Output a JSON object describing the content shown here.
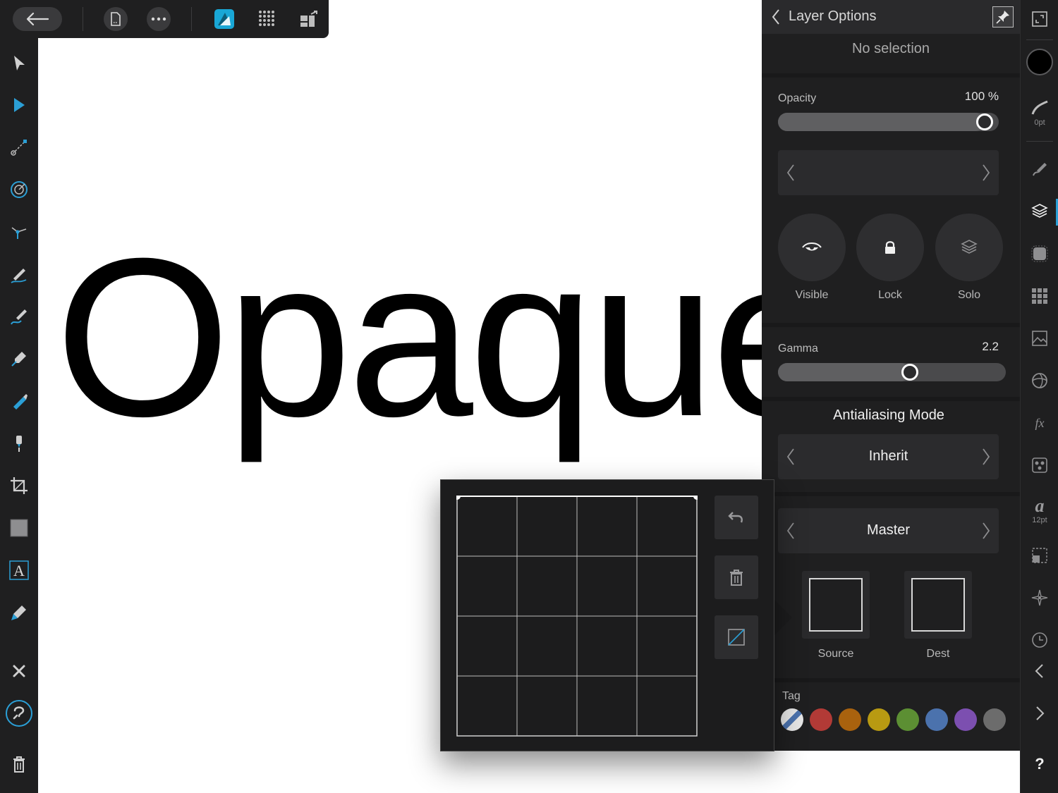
{
  "canvas": {
    "text": "Opaque"
  },
  "topbar": {
    "items": [
      "back-arrow-icon",
      "document-icon",
      "more-icon",
      "app-logo-icon",
      "grid-icon",
      "export-persona-icon"
    ]
  },
  "left_toolbar": {
    "tools": [
      "move-tool-icon",
      "node-tool-icon",
      "fill-tool-icon",
      "transparency-tool-icon",
      "corner-tool-icon",
      "pencil-tool-icon",
      "vector-brush-tool-icon",
      "pen-tool-icon",
      "paint-brush-icon",
      "color-picker-tool-icon",
      "crop-tool-icon",
      "rectangle-tool-icon",
      "artistic-text-tool-icon",
      "eyedropper-icon",
      "close-icon",
      "help-lasso-icon",
      "delete-icon"
    ]
  },
  "panel": {
    "title": "Layer Options",
    "selection_status": "No selection",
    "opacity": {
      "label": "Opacity",
      "value_text": "100 %",
      "value": 1.0
    },
    "visibility": {
      "visible_label": "Visible",
      "lock_label": "Lock",
      "solo_label": "Solo"
    },
    "gamma": {
      "label": "Gamma",
      "value_text": "2.2",
      "value": 0.6
    },
    "antialiasing": {
      "heading": "Antialiasing Mode",
      "value": "Inherit"
    },
    "blend_ranges": {
      "channel": "Master",
      "source_label": "Source",
      "dest_label": "Dest"
    },
    "tag": {
      "label": "Tag",
      "colors": [
        "#c7c7c7",
        "#b23a36",
        "#a9620e",
        "#b89a12",
        "#5c8f33",
        "#4b72ad",
        "#7c4fb0",
        "#6c6c6c"
      ]
    }
  },
  "popup": {
    "buttons": [
      "undo-icon",
      "trash-icon",
      "curve-mode-icon"
    ]
  },
  "right_tabs": {
    "stroke_width": "0pt",
    "font_size": "12pt",
    "help_label": "?"
  },
  "colors": {
    "accent": "#2b9fd6",
    "panel_bg": "#1f1f20",
    "primary_fill": "#000000"
  }
}
